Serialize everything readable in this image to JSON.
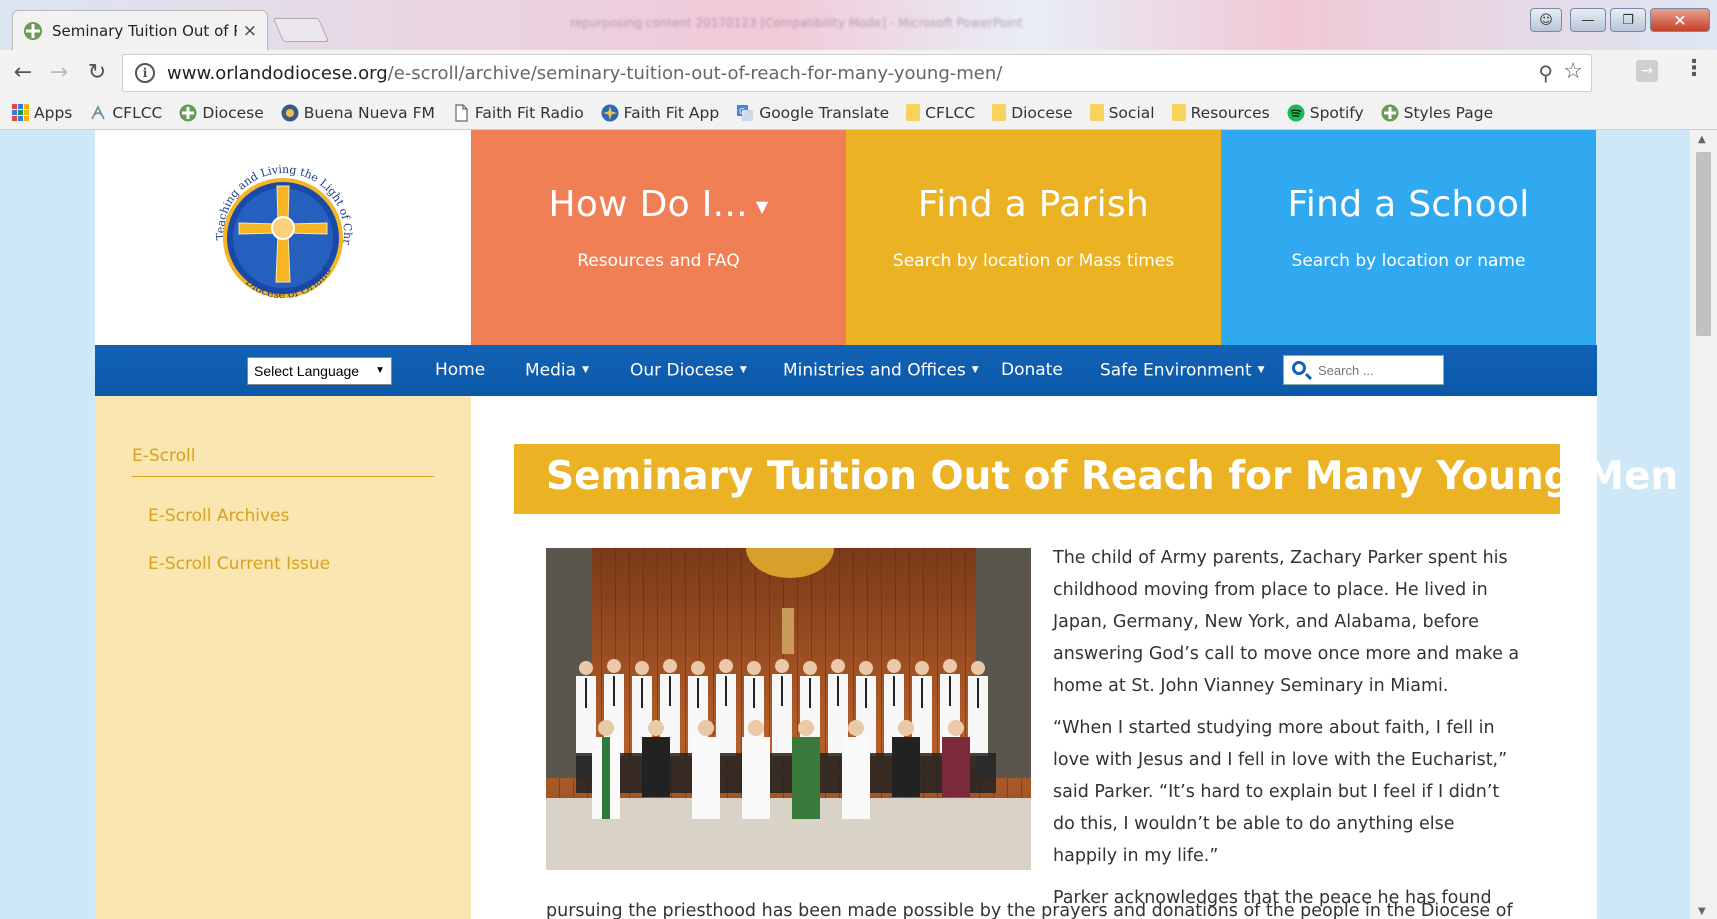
{
  "browser": {
    "tab_title": "Seminary Tuition Out of R",
    "tab_close": "×",
    "window_title": "repurposing content 20170123 [Compatibility Mode] - Microsoft PowerPoint",
    "url_host": "www.orlandodiocese.org",
    "url_path": "/e-scroll/archive/seminary-tuition-out-of-reach-for-many-young-men/",
    "bookmarks": [
      {
        "label": "Apps",
        "icon": "apps-grid-icon"
      },
      {
        "label": "CFLCC",
        "icon": "cflcc-icon"
      },
      {
        "label": "Diocese",
        "icon": "diocese-cross-icon"
      },
      {
        "label": "Buena Nueva FM",
        "icon": "radio-globe-icon"
      },
      {
        "label": "Faith Fit Radio",
        "icon": "page-icon"
      },
      {
        "label": "Faith Fit App",
        "icon": "app-globe-icon"
      },
      {
        "label": "Google Translate",
        "icon": "translate-icon"
      },
      {
        "label": "CFLCC",
        "icon": "folder-icon"
      },
      {
        "label": "Diocese",
        "icon": "folder-icon"
      },
      {
        "label": "Social",
        "icon": "folder-icon"
      },
      {
        "label": "Resources",
        "icon": "folder-icon"
      },
      {
        "label": "Spotify",
        "icon": "spotify-icon"
      },
      {
        "label": "Styles Page",
        "icon": "diocese-cross-icon"
      }
    ]
  },
  "logo": {
    "arc_text": "Teaching and Living the Light of Christ",
    "bottom_text": "Diocese of Orlando"
  },
  "hero": {
    "how": {
      "title": "How Do I...",
      "caret": "▼",
      "subtitle": "Resources and FAQ"
    },
    "parish": {
      "title": "Find a Parish",
      "subtitle": "Search by location or Mass times"
    },
    "school": {
      "title": "Find a School",
      "subtitle": "Search by location or name"
    }
  },
  "nav": {
    "language": "Select Language",
    "items": [
      "Home",
      "Media",
      "Our Diocese",
      "Ministries and Offices",
      "Donate",
      "Safe Environment"
    ],
    "search_placeholder": "Search ..."
  },
  "sidebar": {
    "heading": "E-Scroll",
    "links": [
      "E-Scroll Archives",
      "E-Scroll Current Issue"
    ]
  },
  "article": {
    "title": "Seminary Tuition Out of Reach for Many Young Men",
    "p1": "The child of Army parents, Zachary Parker spent his childhood moving from place to place. He lived in Japan, Germany, New York, and Alabama, before answering God’s call to move once more and make a home at St. John Vianney Seminary in Miami.",
    "p2": "“When I started studying more about faith, I fell in love with Jesus and I fell in love with the Eucharist,” said Parker. “It’s hard to explain but I feel if I didn’t do this, I wouldn’t be able to do anything else happily in my life.”",
    "p3_start": "Parker acknowledges that the peace he has found",
    "p3_cont": "pursuing the priesthood has been made possible by the prayers and donations of the people in the Diocese of"
  },
  "colors": {
    "coral": "#f07f55",
    "gold": "#ebb324",
    "sky": "#30a9f0",
    "navy": "#0b58a8",
    "sidebar": "#f9e6b0"
  }
}
